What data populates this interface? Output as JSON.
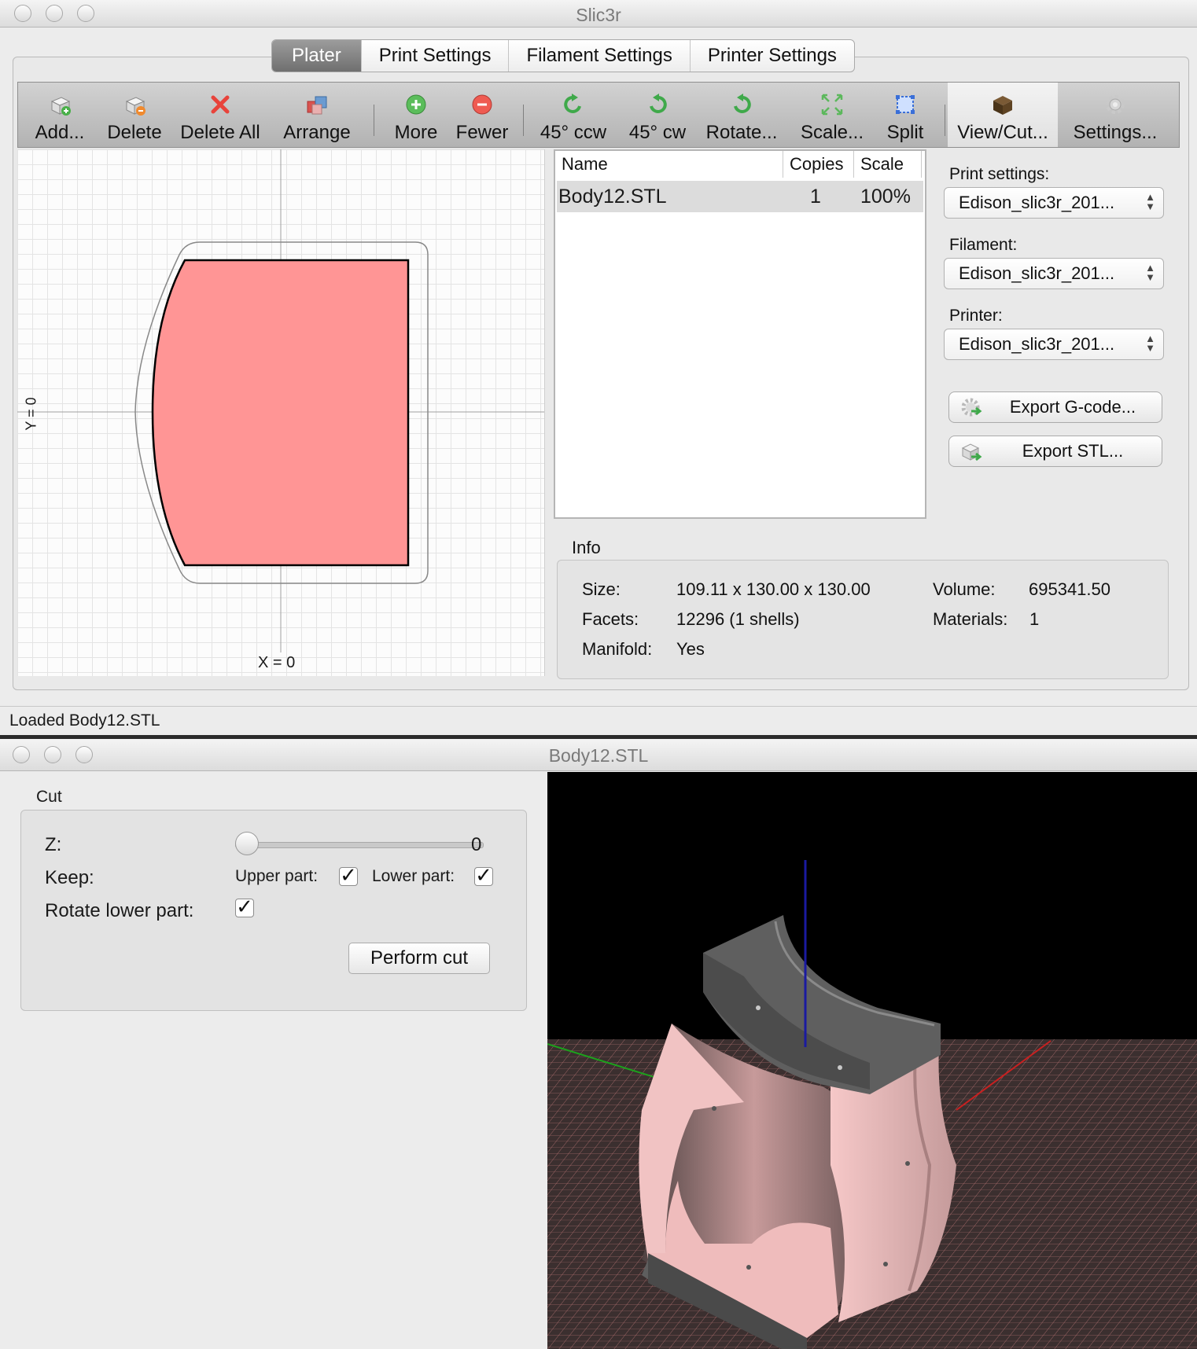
{
  "main_window": {
    "title": "Slic3r",
    "tabs": [
      "Plater",
      "Print Settings",
      "Filament Settings",
      "Printer Settings"
    ],
    "active_tab": "Plater",
    "toolbar": {
      "add": "Add...",
      "delete": "Delete",
      "delete_all": "Delete All",
      "arrange": "Arrange",
      "more": "More",
      "fewer": "Fewer",
      "rotate_ccw": "45° ccw",
      "rotate_cw": "45° cw",
      "rotate": "Rotate...",
      "scale": "Scale...",
      "split": "Split",
      "view_cut": "View/Cut...",
      "settings": "Settings..."
    },
    "plater": {
      "y_axis_label": "Y = 0",
      "x_axis_label": "X = 0"
    },
    "object_list": {
      "columns": [
        "Name",
        "Copies",
        "Scale"
      ],
      "rows": [
        {
          "name": "Body12.STL",
          "copies": "1",
          "scale": "100%"
        }
      ]
    },
    "sidebar": {
      "print_settings_label": "Print settings:",
      "print_settings_value": "Edison_slic3r_201...",
      "filament_label": "Filament:",
      "filament_value": "Edison_slic3r_201...",
      "printer_label": "Printer:",
      "printer_value": "Edison_slic3r_201...",
      "export_gcode": "Export G-code...",
      "export_stl": "Export STL..."
    },
    "info": {
      "heading": "Info",
      "size_label": "Size:",
      "size_value": "109.11 x 130.00 x 130.00",
      "volume_label": "Volume:",
      "volume_value": "695341.50",
      "facets_label": "Facets:",
      "facets_value": "12296 (1 shells)",
      "materials_label": "Materials:",
      "materials_value": "1",
      "manifold_label": "Manifold:",
      "manifold_value": "Yes"
    },
    "status": "Loaded Body12.STL"
  },
  "cut_window": {
    "title": "Body12.STL",
    "group_label": "Cut",
    "z_label": "Z:",
    "z_value": "0",
    "keep_label": "Keep:",
    "upper_part_label": "Upper part:",
    "upper_part_checked": true,
    "lower_part_label": "Lower part:",
    "lower_part_checked": true,
    "rotate_lower_label": "Rotate lower part:",
    "rotate_lower_checked": true,
    "perform_cut": "Perform cut",
    "check_glyph": "✓"
  },
  "colors": {
    "object_fill": "#ff9595",
    "model_light": "#f3c2c2",
    "model_dark": "#5e5e5e",
    "viewport_bg": "#000000",
    "bed_grid": "#b07070"
  }
}
